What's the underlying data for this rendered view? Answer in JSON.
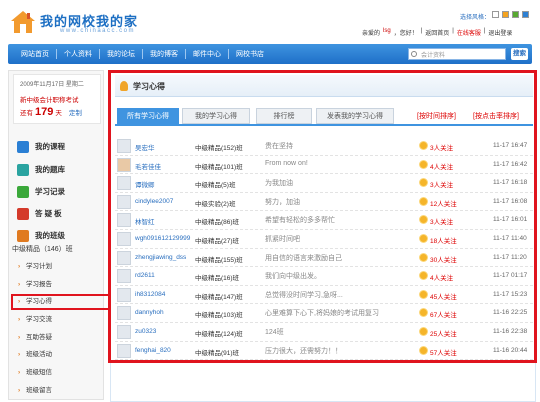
{
  "header": {
    "logo_text": "我的网校我的家",
    "logo_url": "www.chinaacc.com",
    "style_label": "选择风格：",
    "style_colors": [
      "#ffffff",
      "#f3a21e",
      "#58a831",
      "#2d7fd2"
    ],
    "greeting": "亲爱的",
    "username": "lsg",
    "welcome": "，您好！",
    "links": [
      "返回首页",
      "在线客服",
      "退出登录"
    ]
  },
  "nav": {
    "items": [
      "网站首页",
      "个人资料",
      "我的论坛",
      "我的博客",
      "邮件中心",
      "网校书店"
    ],
    "search_placeholder": "会计资料",
    "search_button": "搜索"
  },
  "sidebar": {
    "date": "2009年11月17日  星期二",
    "countdown_title": "新中级会计职称考试",
    "countdown_prefix": "还有",
    "countdown_days": "179",
    "countdown_unit": "天",
    "countdown_set": "定制",
    "menu": [
      {
        "label": "我的课程",
        "icon": "course-icon",
        "color": "ic-blue"
      },
      {
        "label": "我的题库",
        "icon": "question-bank-icon",
        "color": "ic-teal"
      },
      {
        "label": "学习记录",
        "icon": "record-icon",
        "color": "ic-green"
      },
      {
        "label": "答  疑  板",
        "icon": "qa-icon",
        "color": "ic-red"
      },
      {
        "label": "我的班级",
        "icon": "class-icon",
        "color": "ic-orange"
      }
    ],
    "class_title": "中级精品（146）班",
    "class_items": [
      "学习计划",
      "学习报告",
      "学习心得",
      "学习交流",
      "互助答疑",
      "班级活动",
      "班级短信",
      "班级留言"
    ]
  },
  "main": {
    "title": "学习心得",
    "tabs": [
      "所有学习心得",
      "我的学习心得",
      "排行榜",
      "发表我的学习心得"
    ],
    "sort_time": "[按时间排序]",
    "sort_click": "[按点击率排序]",
    "rows": [
      {
        "name": "吴宏华",
        "cls": "中级精品(152)班",
        "msg": "贵在坚持",
        "follow": "3人关注",
        "time": "11-17 16:47"
      },
      {
        "name": "毛若佳佳",
        "cls": "中级精品(101)班",
        "msg": "From now on!",
        "follow": "4人关注",
        "time": "11-17 16:42"
      },
      {
        "name": "谭微卿",
        "cls": "中级精品(5)班",
        "msg": "为我加油",
        "follow": "3人关注",
        "time": "11-17 16:18"
      },
      {
        "name": "cindylee2007",
        "cls": "中级实验(2)班",
        "msg": "努力，加油",
        "follow": "12人关注",
        "time": "11-17 16:08"
      },
      {
        "name": "林智红",
        "cls": "中级精品(86)班",
        "msg": "希望有轻松的多多帮忙",
        "follow": "3人关注",
        "time": "11-17 16:01"
      },
      {
        "name": "wgh091612129999",
        "cls": "中级精品(27)班",
        "msg": "抓紧时间吧",
        "follow": "18人关注",
        "time": "11-17 11:40"
      },
      {
        "name": "zhengjiawing_dss",
        "cls": "中级精品(155)班",
        "msg": "用自信的语言来激励自己",
        "follow": "30人关注",
        "time": "11-17 11:20"
      },
      {
        "name": "rd2611",
        "cls": "中级精品(16)班",
        "msg": "我们向中级出发。",
        "follow": "4人关注",
        "time": "11-17 01:17"
      },
      {
        "name": "ih8312084",
        "cls": "中级精品(147)班",
        "msg": "总觉得没时间学习,急呀...",
        "follow": "45人关注",
        "time": "11-17 15:23"
      },
      {
        "name": "dannyhoh",
        "cls": "中级精品(103)班",
        "msg": "心里难算下心下,将妈娘的考试用复习",
        "follow": "67人关注",
        "time": "11-16 22:25"
      },
      {
        "name": "zu0323",
        "cls": "中级精品(124)班",
        "msg": "124班",
        "follow": "25人关注",
        "time": "11-16 22:38"
      },
      {
        "name": "fenghai_820",
        "cls": "中级精品(91)班",
        "msg": "压力很大，还需努力！！",
        "follow": "57人关注",
        "time": "11-16 20:44"
      }
    ]
  }
}
